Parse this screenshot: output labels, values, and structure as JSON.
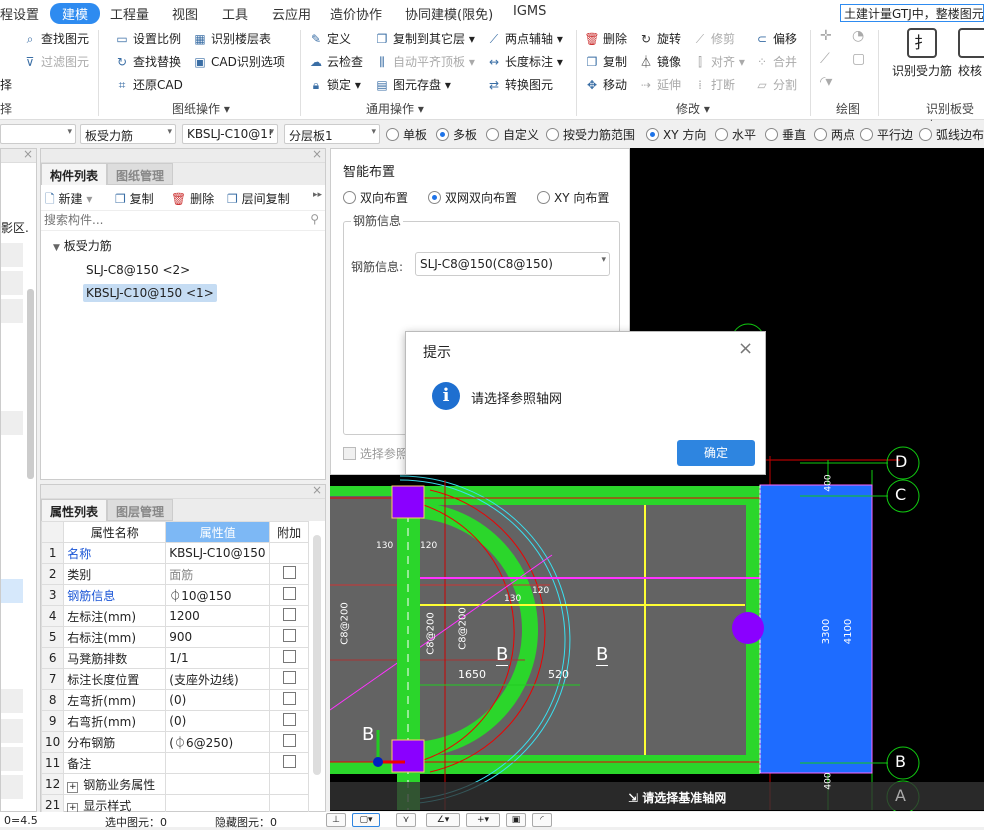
{
  "menu": {
    "tabs": [
      "程设置",
      "建模",
      "工程量",
      "视图",
      "工具",
      "云应用",
      "造价协作",
      "协同建模(限免)",
      "IGMS"
    ],
    "active": "建模",
    "quick_search": "土建计量GTJ中，整楼图元"
  },
  "ribbon": {
    "col0": {
      "find": "查找图元",
      "filter": "过滤图元",
      "sel_partial": "择",
      "group_partial": "择"
    },
    "drawing_ops": {
      "set_scale": "设置比例",
      "find_replace": "查找替换",
      "restore_cad": "还原CAD",
      "identify_floor_table": "识别楼层表",
      "cad_options": "CAD识别选项",
      "label": "图纸操作"
    },
    "general_ops": {
      "define": "定义",
      "cloud_check": "云检查",
      "lock": "锁定",
      "copy_to_layer": "复制到其它层",
      "auto_align_top": "自动平齐顶板",
      "element_save": "图元存盘",
      "two_point_axis": "两点辅轴",
      "length_dim": "长度标注",
      "convert_element": "转换图元",
      "label": "通用操作"
    },
    "modify": {
      "delete": "删除",
      "copy": "复制",
      "move": "移动",
      "rotate": "旋转",
      "mirror": "镜像",
      "extend": "延伸",
      "trim": "修剪",
      "align": "对齐",
      "break": "打断",
      "offset": "偏移",
      "merge": "合并",
      "split": "分割",
      "label": "修改"
    },
    "draw": {
      "label": "绘图"
    },
    "identify": {
      "identify_rebar": "识别受力筋",
      "check_partial": "校核",
      "label": "识别板受力"
    }
  },
  "toolbar": {
    "dropdowns": [
      "",
      "板受力筋",
      "KBSLJ-C10@1!",
      "分层板1"
    ],
    "scope": [
      {
        "label": "单板",
        "on": false
      },
      {
        "label": "多板",
        "on": true
      },
      {
        "label": "自定义",
        "on": false
      },
      {
        "label": "按受力筋范围",
        "on": false
      }
    ],
    "direction": [
      {
        "label": "XY 方向",
        "on": true
      },
      {
        "label": "水平",
        "on": false
      },
      {
        "label": "垂直",
        "on": false
      },
      {
        "label": "两点",
        "on": false
      },
      {
        "label": "平行边",
        "on": false
      },
      {
        "label": "弧线边布",
        "on": false
      }
    ]
  },
  "left_panel": {
    "partial_text": "影区."
  },
  "component_list": {
    "tabs": [
      "构件列表",
      "图纸管理"
    ],
    "actions": {
      "new": "新建",
      "copy": "复制",
      "delete": "删除",
      "floor_copy": "层间复制"
    },
    "search_placeholder": "搜索构件...",
    "tree": {
      "group": "板受力筋",
      "items": [
        {
          "label": "SLJ-C8@150 <2>",
          "selected": false
        },
        {
          "label": "KBSLJ-C10@150 <1>",
          "selected": true
        }
      ]
    }
  },
  "properties": {
    "tabs": [
      "属性列表",
      "图层管理"
    ],
    "headers": [
      "属性名称",
      "属性值",
      "附加"
    ],
    "rows": [
      {
        "no": "1",
        "name": "名称",
        "value": "KBSLJ-C10@150",
        "link": true,
        "check": false
      },
      {
        "no": "2",
        "name": "类别",
        "value": "面筋",
        "link": false,
        "check": true
      },
      {
        "no": "3",
        "name": "钢筋信息",
        "value": "⏀10@150",
        "link": true,
        "check": true
      },
      {
        "no": "4",
        "name": "左标注(mm)",
        "value": "1200",
        "link": false,
        "check": true
      },
      {
        "no": "5",
        "name": "右标注(mm)",
        "value": "900",
        "link": false,
        "check": true
      },
      {
        "no": "6",
        "name": "马凳筋排数",
        "value": "1/1",
        "link": false,
        "check": true
      },
      {
        "no": "7",
        "name": "标注长度位置",
        "value": "(支座外边线)",
        "link": false,
        "check": true
      },
      {
        "no": "8",
        "name": "左弯折(mm)",
        "value": "(0)",
        "link": false,
        "check": true
      },
      {
        "no": "9",
        "name": "右弯折(mm)",
        "value": "(0)",
        "link": false,
        "check": true
      },
      {
        "no": "10",
        "name": "分布钢筋",
        "value": "(⏀6@250)",
        "link": false,
        "check": true
      },
      {
        "no": "11",
        "name": "备注",
        "value": "",
        "link": false,
        "check": true
      },
      {
        "no": "12",
        "name": "钢筋业务属性",
        "value": "",
        "expand": true
      },
      {
        "no": "21",
        "name": "显示样式",
        "value": "",
        "expand": true
      }
    ]
  },
  "smart_layout": {
    "title": "智能布置",
    "options": [
      {
        "label": "双向布置",
        "on": false
      },
      {
        "label": "双网双向布置",
        "on": true
      },
      {
        "label": "XY 向布置",
        "on": false
      }
    ],
    "group_title": "钢筋信息",
    "field_label": "钢筋信息:",
    "field_value": "SLJ-C8@150(C8@150)",
    "checkbox_label": "选择参照"
  },
  "dialog": {
    "title": "提示",
    "message": "请选择参照轴网",
    "ok": "确定"
  },
  "canvas": {
    "prompt": "请选择基准轴网",
    "axes": [
      "D",
      "C",
      "B",
      "A"
    ],
    "labels": {
      "c8": "C8@200",
      "d130": "130",
      "d120": "120",
      "d1650": "1650",
      "d520": "520",
      "B": "B",
      "d3300": "3300",
      "d4100": "4100",
      "d400": "400"
    },
    "colors": {
      "slab": "#2bd62b",
      "fill": "#636363",
      "column": "#8a00ff",
      "blue_slab": "#1e6cff",
      "rebar_y": "#ffff33",
      "rebar_m": "#ff33ff"
    }
  },
  "status": {
    "coord": "0=4.5",
    "selected": "选中图元：0",
    "hidden": "隐藏图元：0"
  }
}
